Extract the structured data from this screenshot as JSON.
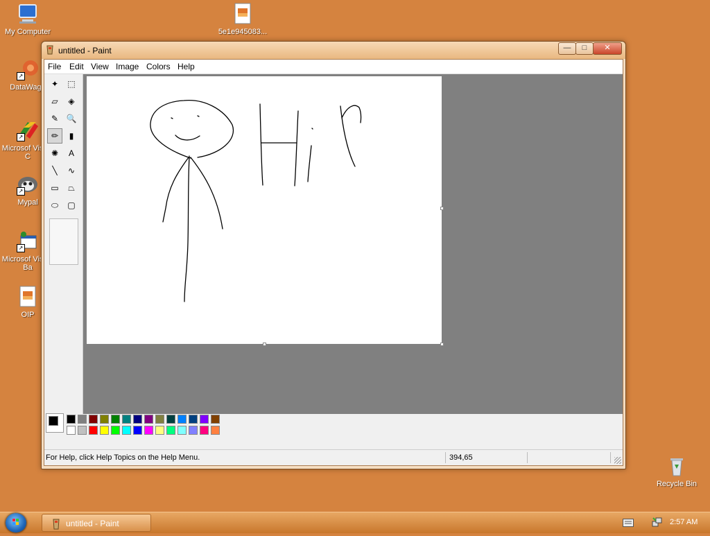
{
  "desktop": {
    "icons": [
      {
        "label": "My Computer",
        "icon": "computer-icon"
      },
      {
        "label": "5e1e945083...",
        "icon": "image-file-icon"
      },
      {
        "label": "DataWago",
        "icon": "datawagon-icon"
      },
      {
        "label": "Microsof Visual C",
        "icon": "visual-c-icon"
      },
      {
        "label": "Mypal",
        "icon": "mypal-browser-icon"
      },
      {
        "label": "Microsof Visual Ba",
        "icon": "visual-basic-icon"
      },
      {
        "label": "OIP",
        "icon": "image-file-icon"
      },
      {
        "label": "Recycle Bin",
        "icon": "recycle-bin-icon"
      }
    ]
  },
  "window": {
    "title": "untitled - Paint",
    "buttons": {
      "minimize": "—",
      "maximize": "□",
      "close": "✕"
    },
    "menu": [
      "File",
      "Edit",
      "View",
      "Image",
      "Colors",
      "Help"
    ]
  },
  "tools": [
    {
      "name": "free-form-select-icon",
      "glyph": "✦"
    },
    {
      "name": "rect-select-icon",
      "glyph": "⬚"
    },
    {
      "name": "eraser-icon",
      "glyph": "▱"
    },
    {
      "name": "fill-bucket-icon",
      "glyph": "◈"
    },
    {
      "name": "color-picker-icon",
      "glyph": "✎"
    },
    {
      "name": "magnifier-icon",
      "glyph": "🔍"
    },
    {
      "name": "pencil-icon",
      "glyph": "✏",
      "selected": true
    },
    {
      "name": "brush-icon",
      "glyph": "▮"
    },
    {
      "name": "airbrush-icon",
      "glyph": "✺"
    },
    {
      "name": "text-icon",
      "glyph": "A"
    },
    {
      "name": "line-icon",
      "glyph": "╲"
    },
    {
      "name": "curve-icon",
      "glyph": "∿"
    },
    {
      "name": "rectangle-icon",
      "glyph": "▭"
    },
    {
      "name": "polygon-icon",
      "glyph": "⏢"
    },
    {
      "name": "ellipse-icon",
      "glyph": "⬭"
    },
    {
      "name": "rounded-rect-icon",
      "glyph": "▢"
    }
  ],
  "palette": {
    "top": [
      "#000000",
      "#808080",
      "#800000",
      "#808000",
      "#008000",
      "#008080",
      "#000080",
      "#800080",
      "#808040",
      "#004040",
      "#0080ff",
      "#004080",
      "#8000ff",
      "#804000"
    ],
    "bottom": [
      "#ffffff",
      "#c0c0c0",
      "#ff0000",
      "#ffff00",
      "#00ff00",
      "#00ffff",
      "#0000ff",
      "#ff00ff",
      "#ffff80",
      "#00ff80",
      "#80ffff",
      "#8080ff",
      "#ff0080",
      "#ff8040"
    ],
    "foreground": "#000000",
    "background": "#ffffff"
  },
  "status": {
    "help_text": "For Help, click Help Topics on the Help Menu.",
    "coords": "394,65"
  },
  "taskbar": {
    "task_label": "untitled - Paint",
    "clock": "2:57 AM"
  }
}
